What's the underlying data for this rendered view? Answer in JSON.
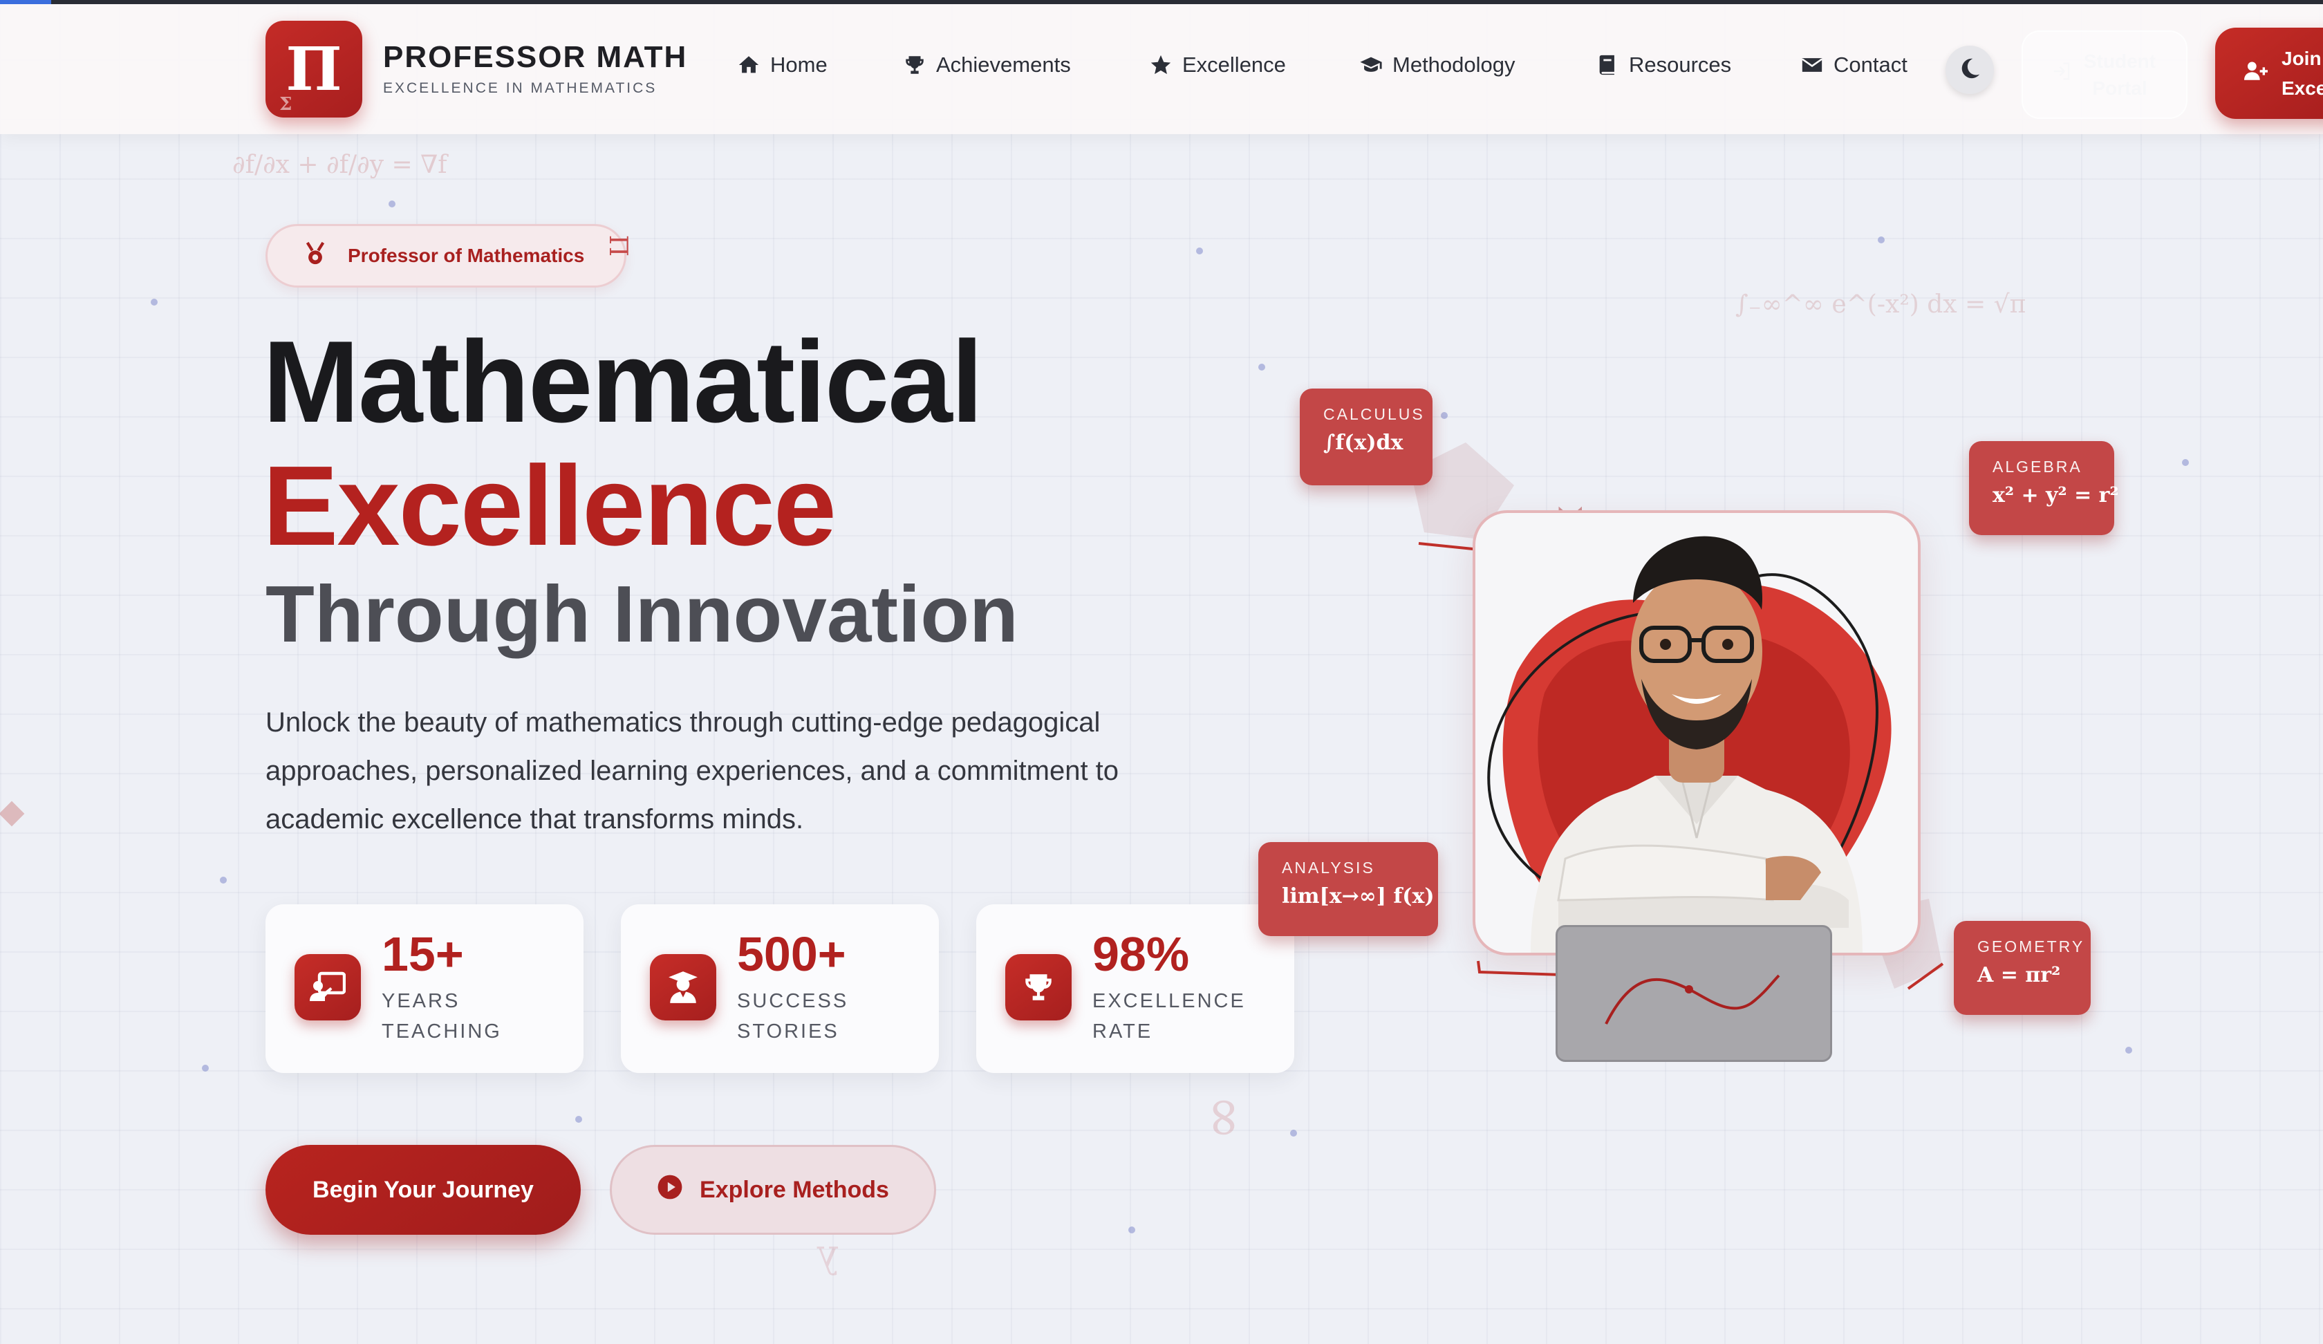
{
  "brand": {
    "logo_symbol": "Π",
    "logo_subscript": "Σ",
    "name": "PROFESSOR MATH",
    "tagline": "EXCELLENCE IN MATHEMATICS"
  },
  "nav": {
    "items": [
      {
        "label": "Home",
        "icon": "home-icon"
      },
      {
        "label": "Achievements",
        "icon": "trophy-icon"
      },
      {
        "label": "Excellence",
        "icon": "star-icon"
      },
      {
        "label": "Methodology",
        "icon": "graduation-cap-icon"
      },
      {
        "label": "Resources",
        "icon": "book-icon"
      },
      {
        "label": "Contact",
        "icon": "envelope-icon"
      }
    ],
    "theme_toggle_icon": "moon-icon",
    "portal_label": "Student Portal",
    "join_label": "Join\nExce"
  },
  "hero": {
    "badge_text": "Professor of Mathematics",
    "badge_icon": "medal-icon",
    "title_line1": "Mathematical",
    "title_line2": "Excellence",
    "title_line3": "Through Innovation",
    "description": "Unlock the beauty of mathematics through cutting-edge pedagogical approaches, personalized learning experiences, and a commitment to academic excellence that transforms minds.",
    "stats": [
      {
        "value": "15+",
        "label": "YEARS\nTEACHING",
        "icon": "chalkboard-teacher-icon"
      },
      {
        "value": "500+",
        "label": "SUCCESS\nSTORIES",
        "icon": "graduate-icon"
      },
      {
        "value": "98%",
        "label": "EXCELLENCE\nRATE",
        "icon": "trophy-icon"
      }
    ],
    "cta_primary": "Begin Your Journey",
    "cta_secondary": "Explore Methods",
    "cta_secondary_icon": "play-circle-icon"
  },
  "formula_cards": [
    {
      "category": "CALCULUS",
      "equation": "∫f(x)dx"
    },
    {
      "category": "ALGEBRA",
      "equation": "x² + y² = r²"
    },
    {
      "category": "ANALYSIS",
      "equation": "lim[x→∞] f(x)"
    },
    {
      "category": "GEOMETRY",
      "equation": "A = πr²"
    }
  ],
  "background_formulas": [
    "∂f/∂x + ∂f/∂y = ∇f",
    "∫₋∞^∞ e^(-x²) dx = √π",
    "∞",
    "λ",
    "Σ",
    "Π"
  ],
  "colors": {
    "brand_red": "#b1211f",
    "card_red": "#c34747",
    "text_dark": "#1a1a1d",
    "text_gray": "#4d4e55",
    "page_bg": "#eef0f5"
  }
}
